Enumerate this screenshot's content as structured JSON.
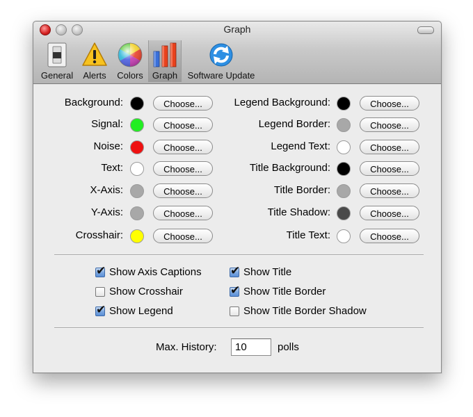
{
  "window": {
    "title": "Graph"
  },
  "toolbar": {
    "items": [
      {
        "label": "General",
        "icon": "switch-icon"
      },
      {
        "label": "Alerts",
        "icon": "warning-icon"
      },
      {
        "label": "Colors",
        "icon": "color-wheel-icon"
      },
      {
        "label": "Graph",
        "icon": "bar-chart-icon",
        "selected": true
      },
      {
        "label": "Software Update",
        "icon": "refresh-icon"
      }
    ]
  },
  "colors": {
    "button_label": "Choose...",
    "left": [
      {
        "label": "Background:",
        "color": "#000000"
      },
      {
        "label": "Signal:",
        "color": "#22ee22"
      },
      {
        "label": "Noise:",
        "color": "#ee1111"
      },
      {
        "label": "Text:",
        "color": "#ffffff"
      },
      {
        "label": "X-Axis:",
        "color": "#a8a8a8"
      },
      {
        "label": "Y-Axis:",
        "color": "#a8a8a8"
      },
      {
        "label": "Crosshair:",
        "color": "#ffff00"
      }
    ],
    "right": [
      {
        "label": "Legend Background:",
        "color": "#000000"
      },
      {
        "label": "Legend Border:",
        "color": "#a8a8a8"
      },
      {
        "label": "Legend Text:",
        "color": "#ffffff"
      },
      {
        "label": "Title Background:",
        "color": "#000000"
      },
      {
        "label": "Title Border:",
        "color": "#a8a8a8"
      },
      {
        "label": "Title Shadow:",
        "color": "#4a4a4a"
      },
      {
        "label": "Title Text:",
        "color": "#ffffff"
      }
    ]
  },
  "options": {
    "left": [
      {
        "label": "Show Axis Captions",
        "checked": true
      },
      {
        "label": "Show Crosshair",
        "checked": false
      },
      {
        "label": "Show Legend",
        "checked": true
      }
    ],
    "right": [
      {
        "label": "Show Title",
        "checked": true
      },
      {
        "label": "Show Title Border",
        "checked": true
      },
      {
        "label": "Show Title Border Shadow",
        "checked": false
      }
    ]
  },
  "history": {
    "label": "Max. History:",
    "value": "10",
    "unit": "polls"
  }
}
